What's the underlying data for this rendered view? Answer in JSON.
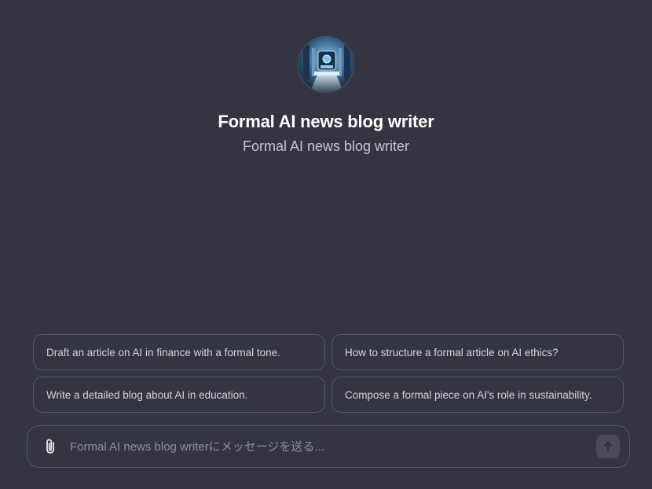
{
  "gpt": {
    "name": "Formal AI news blog writer",
    "description": "Formal AI news blog writer"
  },
  "suggestions": [
    "Draft an article on AI in finance with a formal tone.",
    "How to structure a formal article on AI ethics?",
    "Write a detailed blog about AI in education.",
    "Compose a formal piece on AI's role in sustainability."
  ],
  "composer": {
    "placeholder": "Formal AI news blog writerにメッセージを送る...",
    "value": ""
  },
  "icons": {
    "attach": "paperclip-icon",
    "send": "arrow-up-icon",
    "avatar": "gpt-avatar"
  },
  "colors": {
    "background": "#343541",
    "border": "#565869",
    "send_button": "#4a4b57"
  }
}
